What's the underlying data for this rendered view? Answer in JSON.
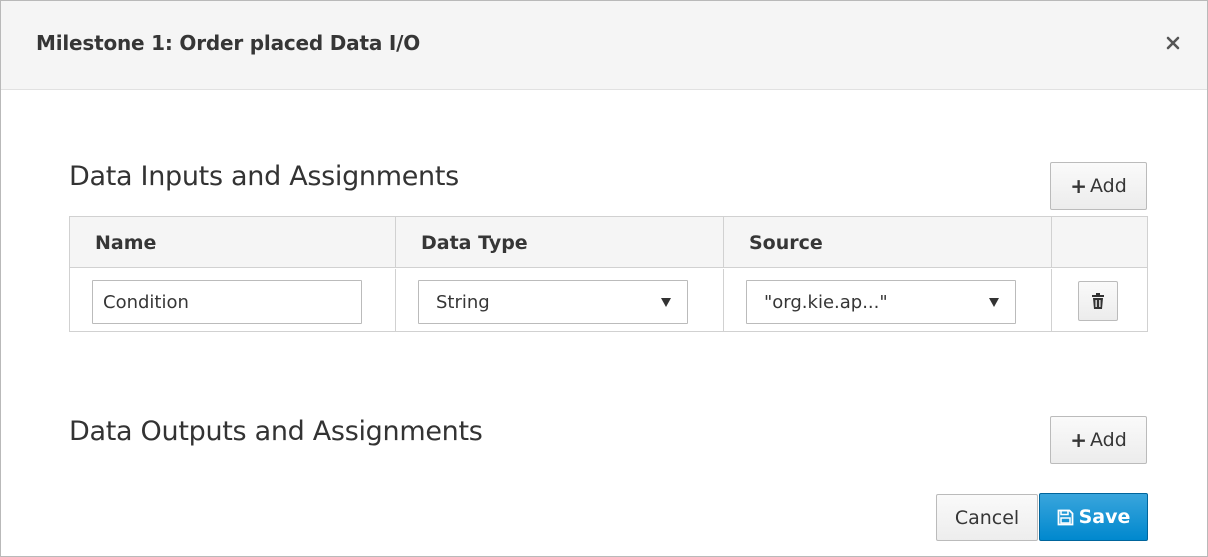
{
  "dialog": {
    "title": "Milestone 1: Order placed Data I/O",
    "close_icon": "close-icon"
  },
  "inputs_section": {
    "title": "Data Inputs and Assignments",
    "add_label": "Add",
    "columns": [
      "Name",
      "Data Type",
      "Source"
    ],
    "rows": [
      {
        "name": "Condition",
        "data_type": "String",
        "source": "\"org.kie.ap...\"",
        "delete_icon": "trash-icon"
      }
    ]
  },
  "outputs_section": {
    "title": "Data Outputs and Assignments",
    "add_label": "Add"
  },
  "footer": {
    "cancel_label": "Cancel",
    "save_label": "Save",
    "save_icon": "save-icon"
  },
  "colors": {
    "primary": "#0088ce",
    "header_bg": "#f5f5f5",
    "border": "#d1d1d1"
  }
}
